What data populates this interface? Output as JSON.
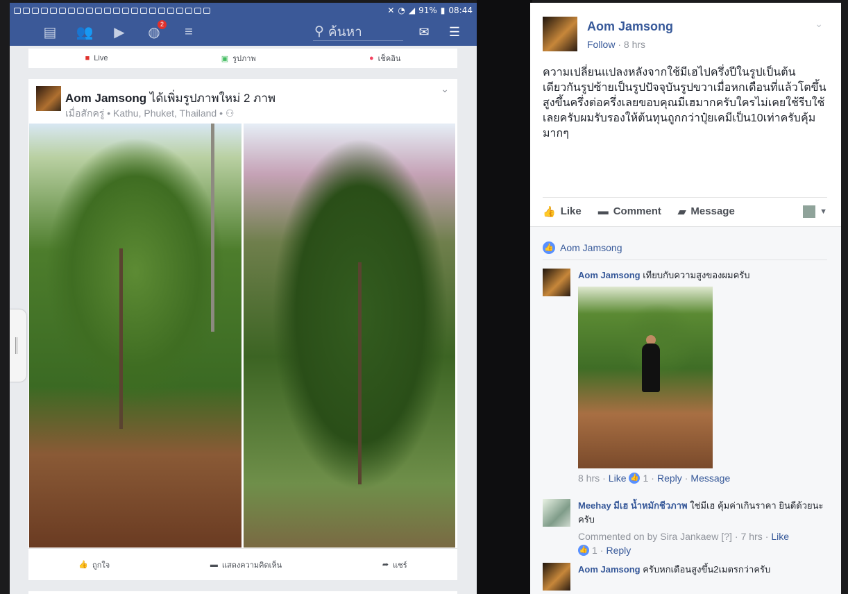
{
  "phone": {
    "status": {
      "battery": "91%",
      "time": "08:44"
    },
    "nav": {
      "notif_badge": "2",
      "search_placeholder": "ค้นหา"
    },
    "composer": {
      "live": "Live",
      "photo": "รูปภาพ",
      "checkin": "เช็คอิน"
    },
    "post": {
      "author": "Aom Jamsong",
      "action": "ได้เพิ่มรูปภาพใหม่ 2 ภาพ",
      "meta": "เมื่อสักครู่ • Kathu, Phuket, Thailand •",
      "actions": {
        "like": "ถูกใจ",
        "comment": "แสดงความคิดเห็น",
        "share": "แชร์"
      }
    }
  },
  "panel": {
    "author": "Aom Jamsong",
    "follow": "Follow",
    "sep": " · ",
    "time": "8 hrs",
    "text": "ความเปลี่ยนแปลงหลังจากใช้มีเฮไปครึ่งปีในรูปเป็นต้นเดียวกันรูปซ้ายเป็นรูปปัจจุบันรูปขวาเมื่อหกเดือนที่แล้วโตขึ้นสูงขึ้นครึ่งต่อครึ่งเลยขอบคุณมีเฮมากครับใครไม่เคยใช้รีบใช้เลยครับผมรับรองให้ต้นทุนถูกกว่าปุ๋ยเคมีเป็น10เท่าครับคุ้มมากๆ",
    "actions": {
      "like": "Like",
      "comment": "Comment",
      "message": "Message"
    },
    "likes_by": "Aom Jamsong",
    "comments": [
      {
        "name": "Aom Jamsong",
        "text": "เทียบกับความสูงของผมครับ",
        "time": "8 hrs",
        "like": "Like",
        "count": "1",
        "reply": "Reply",
        "message": "Message"
      },
      {
        "name": "Meehay มีเฮ น้ำหมักชีวภาพ",
        "text": "ใช่มีเฮ คุ้มค่าเกินราคา ยินดีด้วยนะครับ",
        "commented_on": "Commented on by Sira Jankaew",
        "q": "[?]",
        "time": "7 hrs",
        "like": "Like",
        "count": "1",
        "reply": "Reply"
      },
      {
        "name": "Aom Jamsong",
        "text": "ครับหกเดือนสูงขึ้น2เมตรกว่าครับ"
      }
    ]
  }
}
